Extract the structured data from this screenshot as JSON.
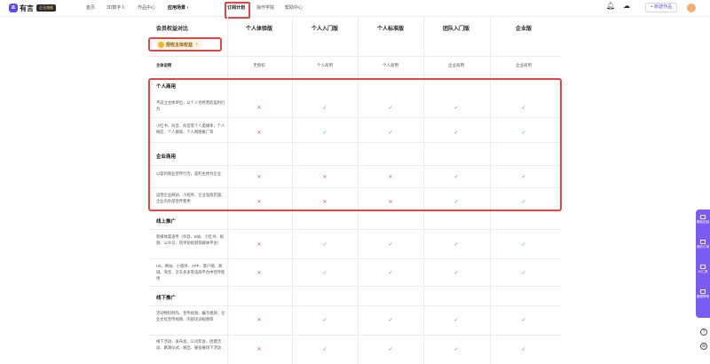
{
  "brand": {
    "name": "有言",
    "badge": "企业旗舰"
  },
  "nav": {
    "items": [
      "首页",
      "3D数字人",
      "作品中心",
      "应用场景 ›",
      "订阅计划",
      "操作学院",
      "帮助中心"
    ]
  },
  "header": {
    "create_label": "+ 新建作品"
  },
  "table": {
    "first_col_title": "会员权益对比",
    "plans": [
      "个人体验版",
      "个人入门版",
      "个人标准版",
      "团队入门版",
      "企业版"
    ],
    "vip_tag": {
      "label": "授权主体权益",
      "toggle": "+"
    },
    "subject_row": {
      "label": "主体说明",
      "values": [
        "无授权",
        "个人商用",
        "个人商用",
        "企业商用",
        "企业商用"
      ]
    },
    "sections": [
      {
        "title": "个人商用",
        "rows": [
          {
            "label": "不成立主体单位，以个人为经营的盈利行为",
            "marks": [
              "x",
              "c",
              "c",
              "c",
              "c"
            ]
          },
          {
            "label": "小红书、抖音、抖音等个人类媒体，个人网店、个人微商、个人网络推广等",
            "marks": [
              "x",
              "c",
              "c",
              "c",
              "c"
            ]
          }
        ]
      },
      {
        "title": "企业商用",
        "rows": [
          {
            "label": "以盈利商业宣传行为，盈利主体为企业",
            "marks": [
              "x",
              "x",
              "x",
              "c",
              "c"
            ]
          },
          {
            "label": "运营企业网站、小程序、企业电商店铺、企业内外部宣传使用",
            "marks": [
              "x",
              "x",
              "x",
              "c",
              "c"
            ]
          }
        ]
      },
      {
        "title": "线上推广",
        "rows": [
          {
            "label": "新媒体渠道传（抖音、B站、小红书、视频、公众号、快手短视频等媒体平台）",
            "marks": [
              "x",
              "c",
              "c",
              "c",
              "c"
            ]
          },
          {
            "label": "H5、网站、小程序、APP、客户端、商城、淘宝、京东多多等电商平台中宣传使用",
            "marks": [
              "x",
              "c",
              "c",
              "c",
              "c"
            ]
          }
        ]
      },
      {
        "title": "线下推广",
        "rows": [
          {
            "label": "活动物料制作、宣传视频、编写视频、企业文化宣传视频、内部培训视频等",
            "marks": [
              "x",
              "c",
              "c",
              "c",
              "c"
            ]
          },
          {
            "label": "线下活动、发布会、公司年会、团建活动、路演仪式、展出、展会展场下活动",
            "marks": [
              "x",
              "c",
              "c",
              "c",
              "c"
            ]
          }
        ]
      }
    ]
  },
  "float_bar": {
    "items": [
      "模板定制",
      "我的订单",
      "AI工具",
      "客服帮助"
    ]
  },
  "side_buttons": [
    "?",
    "⊕"
  ],
  "colors": {
    "accent": "#5b4cf0",
    "highlight": "#e54545",
    "cross": "#e05d5d",
    "check": "#2fae6d",
    "float": "#7b5cf2"
  }
}
